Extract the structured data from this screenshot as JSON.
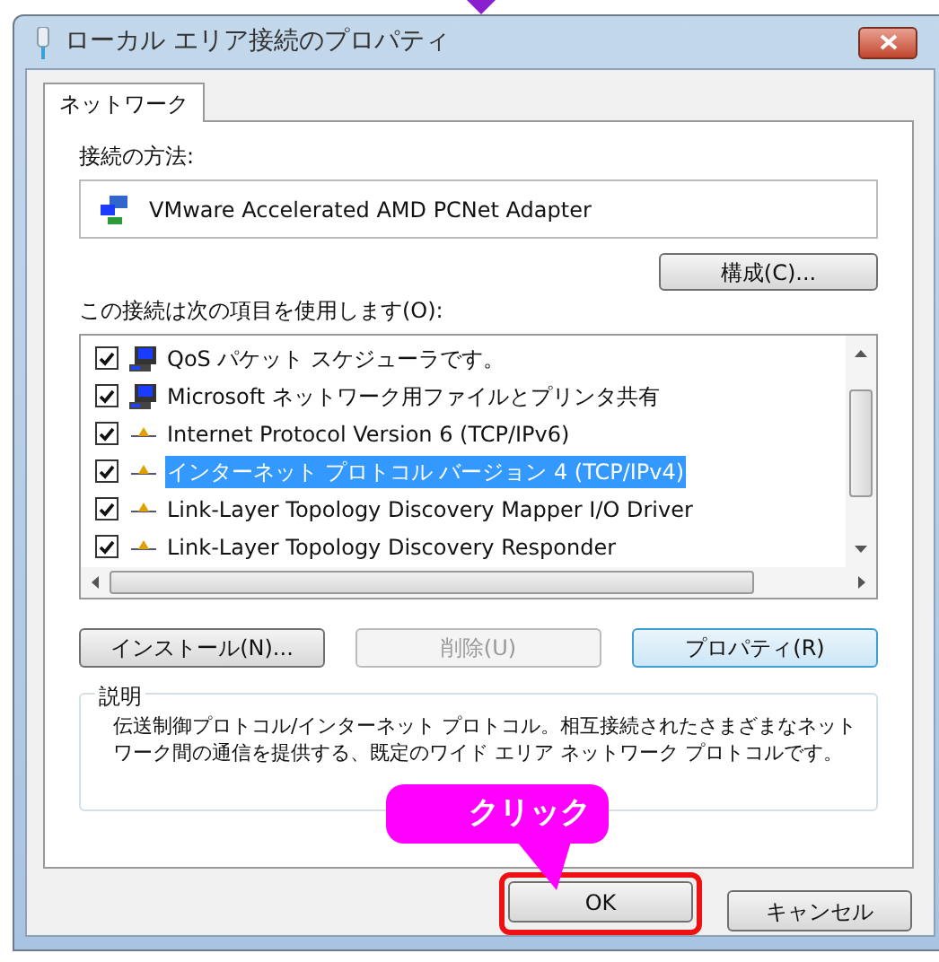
{
  "window": {
    "title": "ローカル エリア接続のプロパティ"
  },
  "tabs": [
    {
      "label": "ネットワーク",
      "selected": true
    }
  ],
  "connect_using": {
    "label": "接続の方法:",
    "adapter": "VMware Accelerated AMD PCNet Adapter"
  },
  "configure_button": "構成(C)...",
  "items_label": "この接続は次の項目を使用します(O):",
  "items": [
    {
      "kind": "service",
      "label": "QoS パケット スケジューラです。",
      "checked": true,
      "selected": false
    },
    {
      "kind": "service",
      "label": "Microsoft ネットワーク用ファイルとプリンタ共有",
      "checked": true,
      "selected": false
    },
    {
      "kind": "protocol",
      "label": "Internet Protocol Version 6 (TCP/IPv6)",
      "checked": true,
      "selected": false
    },
    {
      "kind": "protocol",
      "label": "インターネット プロトコル バージョン 4 (TCP/IPv4)",
      "checked": true,
      "selected": true
    },
    {
      "kind": "protocol",
      "label": "Link-Layer Topology Discovery Mapper I/O Driver",
      "checked": true,
      "selected": false
    },
    {
      "kind": "protocol",
      "label": "Link-Layer Topology Discovery Responder",
      "checked": true,
      "selected": false
    }
  ],
  "item_buttons": [
    {
      "label": "インストール(N)...",
      "disabled": false,
      "focused": false
    },
    {
      "label": "削除(U)",
      "disabled": true,
      "focused": false
    },
    {
      "label": "プロパティ(R)",
      "disabled": false,
      "focused": true
    }
  ],
  "description": {
    "title": "説明",
    "text": "伝送制御プロトコル/インターネット プロトコル。相互接続されたさまざまなネットワーク間の通信を提供する、既定のワイド エリア ネットワーク プロトコルです。"
  },
  "callout": "クリック",
  "dialog_buttons": [
    {
      "label": "OK",
      "highlighted": true
    },
    {
      "label": "キャンセル",
      "highlighted": false
    }
  ]
}
